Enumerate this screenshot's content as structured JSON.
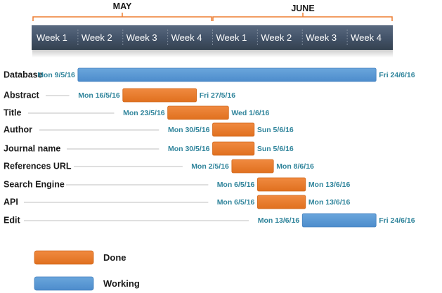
{
  "chart_data": {
    "type": "gantt",
    "months": [
      {
        "label": "MAY",
        "start": "2016-05-02",
        "end": "2016-05-29"
      },
      {
        "label": "JUNE",
        "start": "2016-05-30",
        "end": "2016-06-26"
      }
    ],
    "weeks": [
      "Week 1",
      "Week 2",
      "Week 3",
      "Week 4",
      "Week 1",
      "Week 2",
      "Week 3",
      "Week 4"
    ],
    "tasks": [
      {
        "name": "Database",
        "start": "2016-05-09",
        "end": "2016-06-24",
        "start_label": "Mon 9/5/16",
        "end_label": "Fri 24/6/16",
        "status": "working"
      },
      {
        "name": "Abstract",
        "start": "2016-05-16",
        "end": "2016-05-27",
        "start_label": "Mon 16/5/16",
        "end_label": "Fri 27/5/16",
        "status": "done"
      },
      {
        "name": "Title",
        "start": "2016-05-23",
        "end": "2016-06-01",
        "start_label": "Mon 23/5/16",
        "end_label": "Wed 1/6/16",
        "status": "done"
      },
      {
        "name": "Author",
        "start": "2016-05-30",
        "end": "2016-06-05",
        "start_label": "Mon 30/5/16",
        "end_label": "Sun 5/6/16",
        "status": "done"
      },
      {
        "name": "Journal name",
        "start": "2016-05-30",
        "end": "2016-06-05",
        "start_label": "Mon 30/5/16",
        "end_label": "Sun 5/6/16",
        "status": "done"
      },
      {
        "name": "References URL",
        "start": "2016-06-02",
        "end": "2016-06-08",
        "start_label": "Mon 2/5/16",
        "end_label": "Mon 8/6/16",
        "status": "done"
      },
      {
        "name": "Search Engine",
        "start": "2016-06-06",
        "end": "2016-06-13",
        "start_label": "Mon 6/5/16",
        "end_label": "Mon 13/6/16",
        "status": "done"
      },
      {
        "name": "API",
        "start": "2016-06-06",
        "end": "2016-06-13",
        "start_label": "Mon 6/5/16",
        "end_label": "Mon 13/6/16",
        "status": "done"
      },
      {
        "name": "Edit",
        "start": "2016-06-13",
        "end": "2016-06-24",
        "start_label": "Mon 13/6/16",
        "end_label": "Fri 24/6/16",
        "status": "working"
      }
    ],
    "legend": [
      {
        "key": "done",
        "label": "Done"
      },
      {
        "key": "working",
        "label": "Working"
      }
    ],
    "colors": {
      "done": "#ed7d31",
      "working": "#5b9bd5",
      "timeline": "#44546a",
      "bracket": "#ed7d31",
      "date_text": "#31859c"
    }
  }
}
